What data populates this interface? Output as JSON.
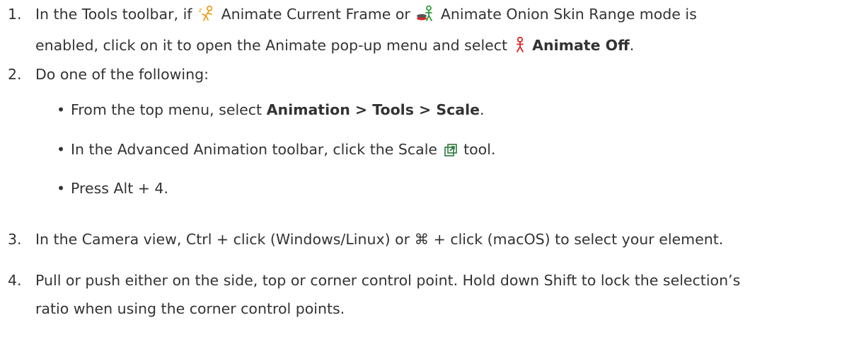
{
  "steps": [
    {
      "number": "1.",
      "line1_a": "In the Tools toolbar, if",
      "icon1": "animate-current-frame-icon",
      "line1_b": "Animate Current Frame or",
      "icon2": "animate-onion-skin-range-icon",
      "line1_c": "Animate Onion Skin Range mode is",
      "line2_a": "enabled, click on it to open the Animate pop-up menu and select",
      "icon3": "animate-off-icon",
      "line2_bold": "Animate Off",
      "line2_end": "."
    },
    {
      "number": "2.",
      "text": "Do one of the following:",
      "bullets": [
        {
          "pre": "From the top menu, select ",
          "bold": "Animation > Tools > Scale",
          "post": "."
        },
        {
          "pre": "In the Advanced Animation toolbar, click the Scale",
          "icon": "scale-tool-icon",
          "post": "tool."
        },
        {
          "pre": "Press Alt + 4."
        }
      ]
    },
    {
      "number": "3.",
      "text_a": "In the Camera view, Ctrl + click (Windows/Linux) or",
      "cmd_glyph": "⌘",
      "text_b": "+ click (macOS) to select your element."
    },
    {
      "number": "4.",
      "line1": "Pull or push either on the side, top or corner control point. Hold down Shift to lock the selection’s",
      "line2": "ratio when using the corner control points."
    }
  ],
  "colors": {
    "text": "#333333",
    "icon_orange": "#f0a020",
    "icon_green": "#2e9e3a",
    "icon_red": "#d62828",
    "icon_scale": "#2c7a3a"
  },
  "bullet_glyph": "•"
}
